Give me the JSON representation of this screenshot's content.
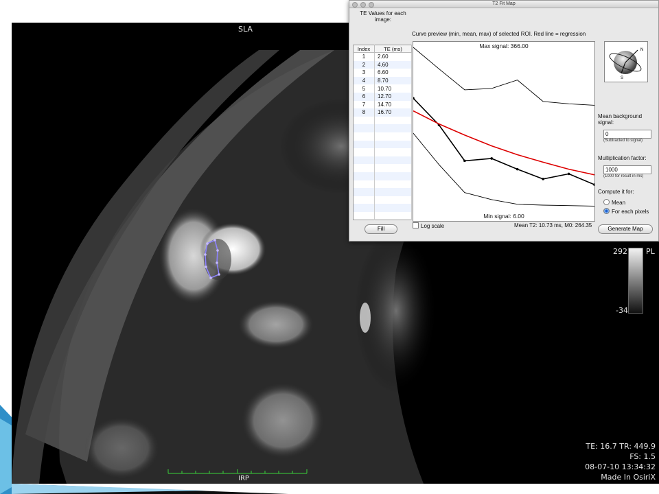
{
  "viewer": {
    "top_orientation": "SLA",
    "bottom_orientation": "IRP",
    "colorbar_max": "292",
    "colorbar_side_label": "PL",
    "colorbar_min": "-34",
    "info_lines": [
      "TE: 16.7 TR: 449.9",
      "FS: 1.5",
      "08-07-10 13:34:32",
      "Made In OsiriX"
    ]
  },
  "dialog": {
    "title": "T2 Fit Map",
    "te_header": "TE Values for each image:",
    "columns": [
      "Index",
      "TE (ms)"
    ],
    "te_rows": [
      {
        "index": "1",
        "te": "2.60"
      },
      {
        "index": "2",
        "te": "4.60"
      },
      {
        "index": "3",
        "te": "6.60"
      },
      {
        "index": "4",
        "te": "8.70"
      },
      {
        "index": "5",
        "te": "10.70"
      },
      {
        "index": "6",
        "te": "12.70"
      },
      {
        "index": "7",
        "te": "14.70"
      },
      {
        "index": "8",
        "te": "16.70"
      }
    ],
    "fill_button": "Fill",
    "curve_title": "Curve preview (min, mean, max) of selected ROI. Red line = regression",
    "max_signal": "Max signal: 366.00",
    "min_signal": "Min signal: 6.00",
    "log_scale_label": "Log scale",
    "log_scale_checked": false,
    "mean_t2": "Mean T2: 10.73 ms, M0: 264.35",
    "mean_bg_label": "Mean background signal:",
    "mean_bg_value": "0",
    "mean_bg_hint": "(Subtracted to signal)",
    "mult_label": "Multiplication factor:",
    "mult_value": "1000",
    "mult_hint": "(1000 for result in ms)",
    "compute_label": "Compute it for:",
    "compute_options": [
      "Mean",
      "For each pixels"
    ],
    "compute_selected": "For each pixels",
    "generate_button": "Generate Map",
    "orientation_letters": [
      "N",
      "S"
    ]
  },
  "chart_data": {
    "type": "line",
    "title": "Curve preview (min, mean, max) of selected ROI. Red line = regression",
    "x": [
      2.6,
      4.6,
      6.6,
      8.7,
      10.7,
      12.7,
      14.7,
      16.7
    ],
    "ylim": [
      6,
      366
    ],
    "series": [
      {
        "name": "max",
        "values": [
          366,
          320,
          275,
          278,
          296,
          250,
          245,
          242
        ]
      },
      {
        "name": "mean",
        "values": [
          257,
          200,
          123,
          128,
          105,
          84,
          95,
          72
        ]
      },
      {
        "name": "min",
        "values": [
          182,
          115,
          55,
          40,
          30,
          28,
          27,
          26
        ]
      },
      {
        "name": "regression",
        "values": [
          230,
          202,
          178,
          155,
          136,
          120,
          105,
          93
        ]
      }
    ],
    "colors": {
      "max": "#000000",
      "mean": "#000000",
      "min": "#000000",
      "regression": "#dd0000"
    }
  }
}
